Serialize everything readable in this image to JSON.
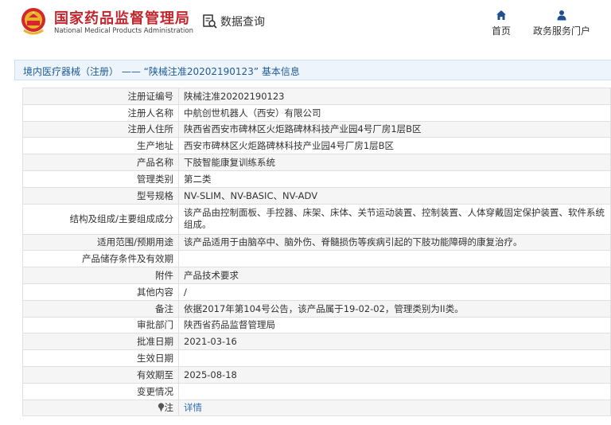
{
  "header": {
    "brand_cn": "国家药品监督管理局",
    "brand_en": "National Medical Products Administration",
    "query_label": "数据查询",
    "nav": [
      {
        "label": "首页",
        "icon": "home-icon"
      },
      {
        "label": "政务服务门户",
        "icon": "user-icon"
      }
    ]
  },
  "title": "境内医疗器械（注册） —— “陕械注准20202190123” 基本信息",
  "rows": [
    {
      "key": "注册证编号",
      "value": "陕械注准20202190123"
    },
    {
      "key": "注册人名称",
      "value": "中航创世机器人（西安）有限公司"
    },
    {
      "key": "注册人住所",
      "value": "陕西省西安市碑林区火炬路碑林科技产业园4号厂房1层B区"
    },
    {
      "key": "生产地址",
      "value": "西安市碑林区火炬路碑林科技产业园4号厂房1层B区"
    },
    {
      "key": "产品名称",
      "value": "下肢智能康复训练系统"
    },
    {
      "key": "管理类别",
      "value": "第二类"
    },
    {
      "key": "型号规格",
      "value": "NV-SLIM、NV-BASIC、NV-ADV"
    },
    {
      "key": "结构及组成/主要组成成分",
      "value": "该产品由控制面板、手控器、床架、床体、关节运动装置、控制装置、人体穿戴固定保护装置、软件系统组成。"
    },
    {
      "key": "适用范围/预期用途",
      "value": "该产品适用于由脑卒中、脑外伤、脊髓损伤等疾病引起的下肢功能障碍的康复治疗。"
    },
    {
      "key": "产品储存条件及有效期",
      "value": ""
    },
    {
      "key": "附件",
      "value": "产品技术要求"
    },
    {
      "key": "其他内容",
      "value": "/"
    },
    {
      "key": "备注",
      "value": "依据2017年第104号公告，该产品属于19-02-02，管理类别为II类。"
    },
    {
      "key": "审批部门",
      "value": "陕西省药品监督管理局"
    },
    {
      "key": "批准日期",
      "value": "2021-03-16"
    },
    {
      "key": "生效日期",
      "value": ""
    },
    {
      "key": "有效期至",
      "value": "2025-08-18"
    },
    {
      "key": "变更情况",
      "value": ""
    },
    {
      "key": "注",
      "value": "详情"
    }
  ],
  "colors": {
    "brand_red": "#c1272d",
    "link_blue": "#2d6fb6",
    "title_blue": "#1f5c99"
  }
}
